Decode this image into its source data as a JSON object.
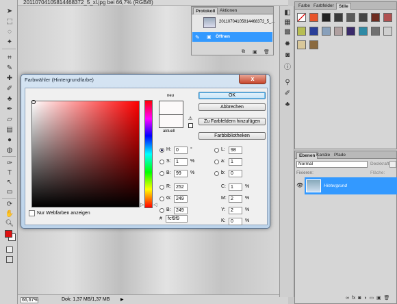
{
  "document": {
    "tab_title": "20110704105814468372_5_xl.jpg bei 66,7% (RGB/8)",
    "zoom": "66,67%",
    "status_info": "Dok: 1,37 MB/1,37 MB"
  },
  "history_panel": {
    "tabs": [
      "Protokoll",
      "Aktionen"
    ],
    "snapshot_label": "20110704105814468372_5_...",
    "open_label": "Öffnen"
  },
  "swatch_panel": {
    "tabs": [
      "Farbe",
      "Farbfelder",
      "Stile"
    ],
    "colors": [
      "#ffffff",
      "#e8542a",
      "#222222",
      "#3b3b3b",
      "#5a5a5a",
      "#444444",
      "#6e2b1f",
      "#b05050",
      "#b7bd52",
      "#2a3f99",
      "#88a0bb",
      "#b0a0a0",
      "#3a2a6a",
      "#2f8aa5",
      "#707070",
      "#cfcfcf",
      "#d8c79a",
      "#8a6a40"
    ]
  },
  "layers_panel": {
    "tabs": [
      "Ebenen",
      "Kanäle",
      "Pfade"
    ],
    "blend_mode": "Normal",
    "opacity_label": "Deckkraft:",
    "lock_label": "Fixieren:",
    "fill_label": "Fläche:",
    "layer_name": "Hintergrund"
  },
  "dialog": {
    "title": "Farbwähler (Hintergrundfarbe)",
    "close": "x",
    "new_label": "neu",
    "current_label": "aktuell",
    "buttons": {
      "ok": "OK",
      "cancel": "Abbrechen",
      "add_swatch": "Zu Farbfeldern hinzufügen",
      "libraries": "Farbbibliotheken"
    },
    "web_colors_label": "Nur Webfarben anzeigen",
    "fields": {
      "H": {
        "label": "H:",
        "value": "0",
        "unit": "°"
      },
      "S": {
        "label": "S:",
        "value": "1",
        "unit": "%"
      },
      "B": {
        "label": "B:",
        "value": "99",
        "unit": "%"
      },
      "R": {
        "label": "R:",
        "value": "252"
      },
      "G": {
        "label": "G:",
        "value": "249"
      },
      "Bb": {
        "label": "B:",
        "value": "249"
      },
      "L": {
        "label": "L:",
        "value": "98"
      },
      "a": {
        "label": "a:",
        "value": "1"
      },
      "b": {
        "label": "b:",
        "value": "0"
      },
      "C": {
        "label": "C:",
        "value": "1",
        "unit": "%"
      },
      "M": {
        "label": "M:",
        "value": "2",
        "unit": "%"
      },
      "Y": {
        "label": "Y:",
        "value": "2",
        "unit": "%"
      },
      "K": {
        "label": "K:",
        "value": "0",
        "unit": "%"
      }
    },
    "hex_label": "#",
    "hex_value": "fcf9f9",
    "selected_color": "#fcf9f9",
    "foreground_color": "#e01010"
  }
}
